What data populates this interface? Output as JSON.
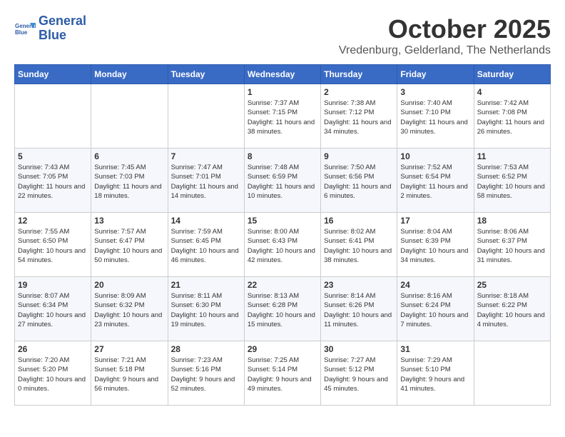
{
  "app": {
    "logo_line1": "General",
    "logo_line2": "Blue"
  },
  "header": {
    "month": "October 2025",
    "location": "Vredenburg, Gelderland, The Netherlands"
  },
  "weekdays": [
    "Sunday",
    "Monday",
    "Tuesday",
    "Wednesday",
    "Thursday",
    "Friday",
    "Saturday"
  ],
  "weeks": [
    [
      {
        "day": "",
        "text": ""
      },
      {
        "day": "",
        "text": ""
      },
      {
        "day": "",
        "text": ""
      },
      {
        "day": "1",
        "text": "Sunrise: 7:37 AM\nSunset: 7:15 PM\nDaylight: 11 hours and 38 minutes."
      },
      {
        "day": "2",
        "text": "Sunrise: 7:38 AM\nSunset: 7:12 PM\nDaylight: 11 hours and 34 minutes."
      },
      {
        "day": "3",
        "text": "Sunrise: 7:40 AM\nSunset: 7:10 PM\nDaylight: 11 hours and 30 minutes."
      },
      {
        "day": "4",
        "text": "Sunrise: 7:42 AM\nSunset: 7:08 PM\nDaylight: 11 hours and 26 minutes."
      }
    ],
    [
      {
        "day": "5",
        "text": "Sunrise: 7:43 AM\nSunset: 7:05 PM\nDaylight: 11 hours and 22 minutes."
      },
      {
        "day": "6",
        "text": "Sunrise: 7:45 AM\nSunset: 7:03 PM\nDaylight: 11 hours and 18 minutes."
      },
      {
        "day": "7",
        "text": "Sunrise: 7:47 AM\nSunset: 7:01 PM\nDaylight: 11 hours and 14 minutes."
      },
      {
        "day": "8",
        "text": "Sunrise: 7:48 AM\nSunset: 6:59 PM\nDaylight: 11 hours and 10 minutes."
      },
      {
        "day": "9",
        "text": "Sunrise: 7:50 AM\nSunset: 6:56 PM\nDaylight: 11 hours and 6 minutes."
      },
      {
        "day": "10",
        "text": "Sunrise: 7:52 AM\nSunset: 6:54 PM\nDaylight: 11 hours and 2 minutes."
      },
      {
        "day": "11",
        "text": "Sunrise: 7:53 AM\nSunset: 6:52 PM\nDaylight: 10 hours and 58 minutes."
      }
    ],
    [
      {
        "day": "12",
        "text": "Sunrise: 7:55 AM\nSunset: 6:50 PM\nDaylight: 10 hours and 54 minutes."
      },
      {
        "day": "13",
        "text": "Sunrise: 7:57 AM\nSunset: 6:47 PM\nDaylight: 10 hours and 50 minutes."
      },
      {
        "day": "14",
        "text": "Sunrise: 7:59 AM\nSunset: 6:45 PM\nDaylight: 10 hours and 46 minutes."
      },
      {
        "day": "15",
        "text": "Sunrise: 8:00 AM\nSunset: 6:43 PM\nDaylight: 10 hours and 42 minutes."
      },
      {
        "day": "16",
        "text": "Sunrise: 8:02 AM\nSunset: 6:41 PM\nDaylight: 10 hours and 38 minutes."
      },
      {
        "day": "17",
        "text": "Sunrise: 8:04 AM\nSunset: 6:39 PM\nDaylight: 10 hours and 34 minutes."
      },
      {
        "day": "18",
        "text": "Sunrise: 8:06 AM\nSunset: 6:37 PM\nDaylight: 10 hours and 31 minutes."
      }
    ],
    [
      {
        "day": "19",
        "text": "Sunrise: 8:07 AM\nSunset: 6:34 PM\nDaylight: 10 hours and 27 minutes."
      },
      {
        "day": "20",
        "text": "Sunrise: 8:09 AM\nSunset: 6:32 PM\nDaylight: 10 hours and 23 minutes."
      },
      {
        "day": "21",
        "text": "Sunrise: 8:11 AM\nSunset: 6:30 PM\nDaylight: 10 hours and 19 minutes."
      },
      {
        "day": "22",
        "text": "Sunrise: 8:13 AM\nSunset: 6:28 PM\nDaylight: 10 hours and 15 minutes."
      },
      {
        "day": "23",
        "text": "Sunrise: 8:14 AM\nSunset: 6:26 PM\nDaylight: 10 hours and 11 minutes."
      },
      {
        "day": "24",
        "text": "Sunrise: 8:16 AM\nSunset: 6:24 PM\nDaylight: 10 hours and 7 minutes."
      },
      {
        "day": "25",
        "text": "Sunrise: 8:18 AM\nSunset: 6:22 PM\nDaylight: 10 hours and 4 minutes."
      }
    ],
    [
      {
        "day": "26",
        "text": "Sunrise: 7:20 AM\nSunset: 5:20 PM\nDaylight: 10 hours and 0 minutes."
      },
      {
        "day": "27",
        "text": "Sunrise: 7:21 AM\nSunset: 5:18 PM\nDaylight: 9 hours and 56 minutes."
      },
      {
        "day": "28",
        "text": "Sunrise: 7:23 AM\nSunset: 5:16 PM\nDaylight: 9 hours and 52 minutes."
      },
      {
        "day": "29",
        "text": "Sunrise: 7:25 AM\nSunset: 5:14 PM\nDaylight: 9 hours and 49 minutes."
      },
      {
        "day": "30",
        "text": "Sunrise: 7:27 AM\nSunset: 5:12 PM\nDaylight: 9 hours and 45 minutes."
      },
      {
        "day": "31",
        "text": "Sunrise: 7:29 AM\nSunset: 5:10 PM\nDaylight: 9 hours and 41 minutes."
      },
      {
        "day": "",
        "text": ""
      }
    ]
  ]
}
